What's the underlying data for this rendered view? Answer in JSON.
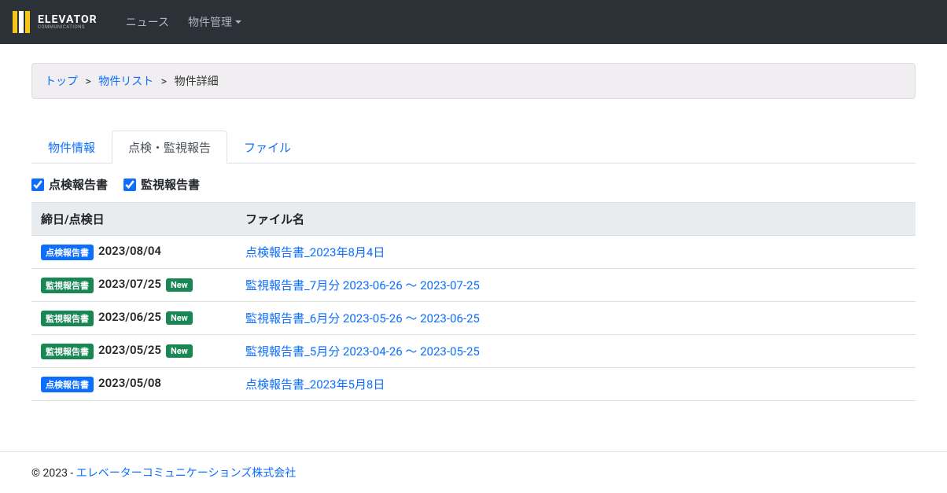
{
  "brand": {
    "main": "ELEVATOR",
    "sub": "COMMUNICATIONS"
  },
  "nav": {
    "news": "ニュース",
    "property_mgmt": "物件管理"
  },
  "breadcrumb": {
    "top": "トップ",
    "list": "物件リスト",
    "current": "物件詳細",
    "sep": ">"
  },
  "tabs": {
    "info": "物件情報",
    "report": "点検・監視報告",
    "file": "ファイル"
  },
  "filters": {
    "inspection": "点検報告書",
    "monitoring": "監視報告書"
  },
  "table": {
    "header_date": "締日/点検日",
    "header_file": "ファイル名"
  },
  "badge_labels": {
    "inspection": "点検報告書",
    "monitoring": "監視報告書",
    "new": "New"
  },
  "rows": [
    {
      "type": "inspection",
      "date": "2023/08/04",
      "is_new": false,
      "file": "点検報告書_2023年8月4日"
    },
    {
      "type": "monitoring",
      "date": "2023/07/25",
      "is_new": true,
      "file": "監視報告書_7月分 2023-06-26 〜 2023-07-25"
    },
    {
      "type": "monitoring",
      "date": "2023/06/25",
      "is_new": true,
      "file": "監視報告書_6月分 2023-05-26 〜 2023-06-25"
    },
    {
      "type": "monitoring",
      "date": "2023/05/25",
      "is_new": true,
      "file": "監視報告書_5月分 2023-04-26 〜 2023-05-25"
    },
    {
      "type": "inspection",
      "date": "2023/05/08",
      "is_new": false,
      "file": "点検報告書_2023年5月8日"
    }
  ],
  "footer": {
    "prefix": "© 2023 - ",
    "company": "エレベーターコミュニケーションズ株式会社"
  }
}
